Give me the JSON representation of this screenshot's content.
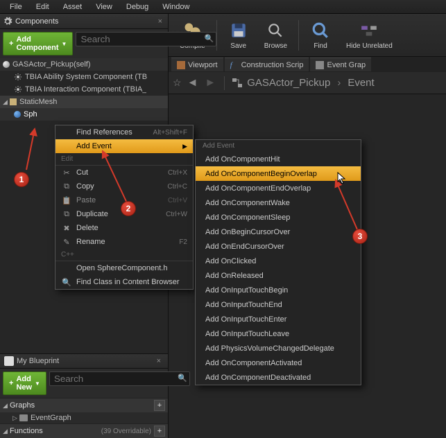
{
  "menubar": [
    "File",
    "Edit",
    "Asset",
    "View",
    "Debug",
    "Window"
  ],
  "components_panel": {
    "title": "Components",
    "add_button": "Add Component",
    "search_placeholder": "Search"
  },
  "component_tree": {
    "root": "GASActor_Pickup(self)",
    "child1": "TBIA Ability System Component (TB",
    "child2": "TBIA Interaction Component (TBIA_",
    "static_mesh": "StaticMesh",
    "sphere": "Sph"
  },
  "my_blueprint": {
    "title": "My Blueprint",
    "add_new": "Add New",
    "search_placeholder": "Search",
    "graphs": "Graphs",
    "event_graph": "EventGraph",
    "functions": "Functions",
    "functions_note": "(39 Overridable)"
  },
  "toolbar": {
    "compile": "Compile",
    "save": "Save",
    "browse": "Browse",
    "find": "Find",
    "hide": "Hide Unrelated"
  },
  "view_tabs": {
    "viewport": "Viewport",
    "construction": "Construction Scrip",
    "event_graph": "Event Grap"
  },
  "breadcrumb": {
    "root": "GASActor_Pickup",
    "leaf": "Event"
  },
  "context_menu": {
    "find_refs": "Find References",
    "find_refs_key": "Alt+Shift+F",
    "add_event": "Add Event",
    "edit_header": "Edit",
    "cut": "Cut",
    "cut_key": "Ctrl+X",
    "copy": "Copy",
    "copy_key": "Ctrl+C",
    "paste": "Paste",
    "paste_key": "Ctrl+V",
    "duplicate": "Duplicate",
    "duplicate_key": "Ctrl+W",
    "delete": "Delete",
    "rename": "Rename",
    "rename_key": "F2",
    "cpp_header": "C++",
    "open_file": "Open SphereComponent.h",
    "find_class": "Find Class in Content Browser"
  },
  "submenu": {
    "header": "Add Event",
    "items": [
      "Add OnComponentHit",
      "Add OnComponentBeginOverlap",
      "Add OnComponentEndOverlap",
      "Add OnComponentWake",
      "Add OnComponentSleep",
      "Add OnBeginCursorOver",
      "Add OnEndCursorOver",
      "Add OnClicked",
      "Add OnReleased",
      "Add OnInputTouchBegin",
      "Add OnInputTouchEnd",
      "Add OnInputTouchEnter",
      "Add OnInputTouchLeave",
      "Add PhysicsVolumeChangedDelegate",
      "Add OnComponentActivated",
      "Add OnComponentDeactivated"
    ],
    "highlight_index": 1
  },
  "markers": {
    "m1": "1",
    "m2": "2",
    "m3": "3"
  }
}
